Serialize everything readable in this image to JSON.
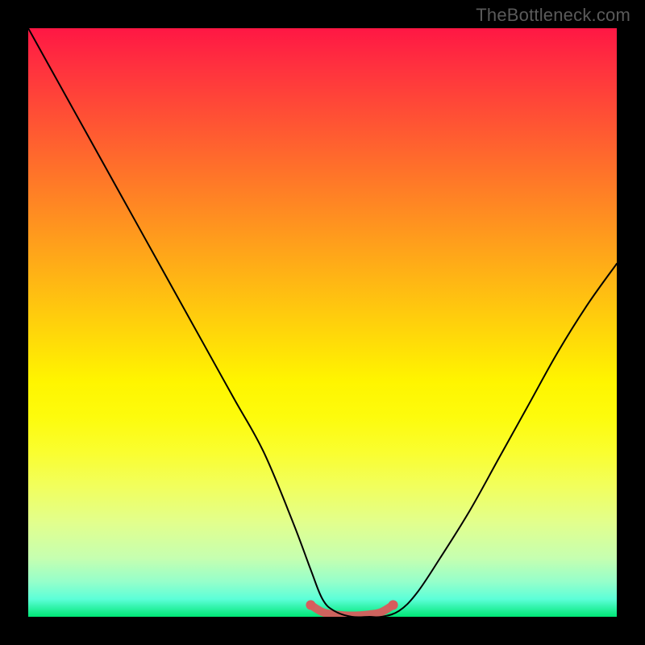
{
  "watermark": "TheBottleneck.com",
  "chart_data": {
    "type": "line",
    "title": "",
    "xlabel": "",
    "ylabel": "",
    "xlim": [
      0,
      100
    ],
    "ylim": [
      0,
      100
    ],
    "grid": false,
    "legend": false,
    "series": [
      {
        "name": "curve",
        "x": [
          0,
          5,
          10,
          15,
          20,
          25,
          30,
          35,
          40,
          45,
          48,
          50,
          52,
          55,
          58,
          60,
          63,
          66,
          70,
          75,
          80,
          85,
          90,
          95,
          100
        ],
        "values": [
          100,
          91,
          82,
          73,
          64,
          55,
          46,
          37,
          28,
          16,
          8,
          3,
          1,
          0,
          0,
          0,
          1,
          4,
          10,
          18,
          27,
          36,
          45,
          53,
          60
        ]
      }
    ],
    "highlight": {
      "x": [
        48,
        50,
        52,
        55,
        58,
        60,
        62
      ],
      "values": [
        2,
        0.8,
        0.4,
        0.2,
        0.4,
        0.8,
        2
      ]
    },
    "colors": {
      "background_top": "#ff1744",
      "background_bottom": "#00e676",
      "curve": "#000000",
      "highlight": "#d85c5c"
    }
  }
}
